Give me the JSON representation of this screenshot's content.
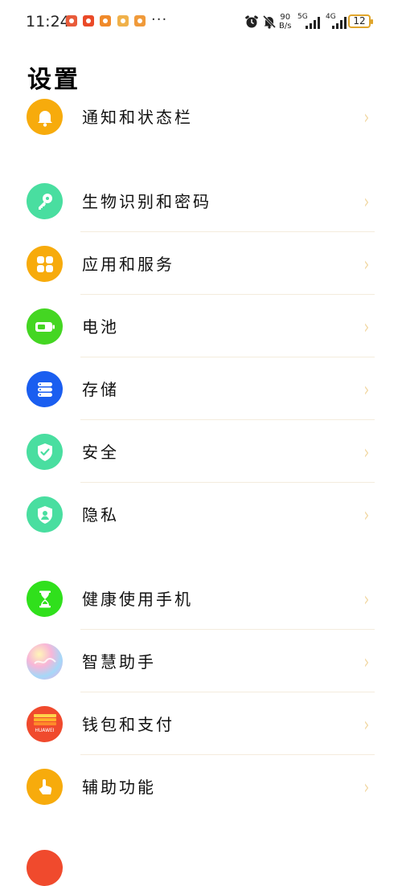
{
  "status": {
    "time": "11:24",
    "more": "···",
    "speed_value": "90",
    "speed_unit": "B/s",
    "sig1": "5G",
    "sig2": "4G",
    "battery": "12"
  },
  "page_title": "设置",
  "settings": [
    {
      "label": "通知和状态栏",
      "icon": "bell-icon",
      "color": "#f7ab0c"
    },
    {
      "label": "生物识别和密码",
      "icon": "key-icon",
      "color": "#49dea0"
    },
    {
      "label": "应用和服务",
      "icon": "apps-icon",
      "color": "#f7ab0c"
    },
    {
      "label": "电池",
      "icon": "battery-icon",
      "color": "#44d622"
    },
    {
      "label": "存储",
      "icon": "storage-icon",
      "color": "#1a5ef0"
    },
    {
      "label": "安全",
      "icon": "shield-check-icon",
      "color": "#49dea0"
    },
    {
      "label": "隐私",
      "icon": "privacy-icon",
      "color": "#49dea0"
    },
    {
      "label": "健康使用手机",
      "icon": "hourglass-icon",
      "color": "#30e01c"
    },
    {
      "label": "智慧助手",
      "icon": "assistant-icon",
      "color": "#f0c6e8"
    },
    {
      "label": "钱包和支付",
      "icon": "wallet-icon",
      "color": "#f04a2d"
    },
    {
      "label": "辅助功能",
      "icon": "hand-tap-icon",
      "color": "#f7ab0c"
    }
  ],
  "wallet_brand": "HUAWEI",
  "chevron": "›"
}
